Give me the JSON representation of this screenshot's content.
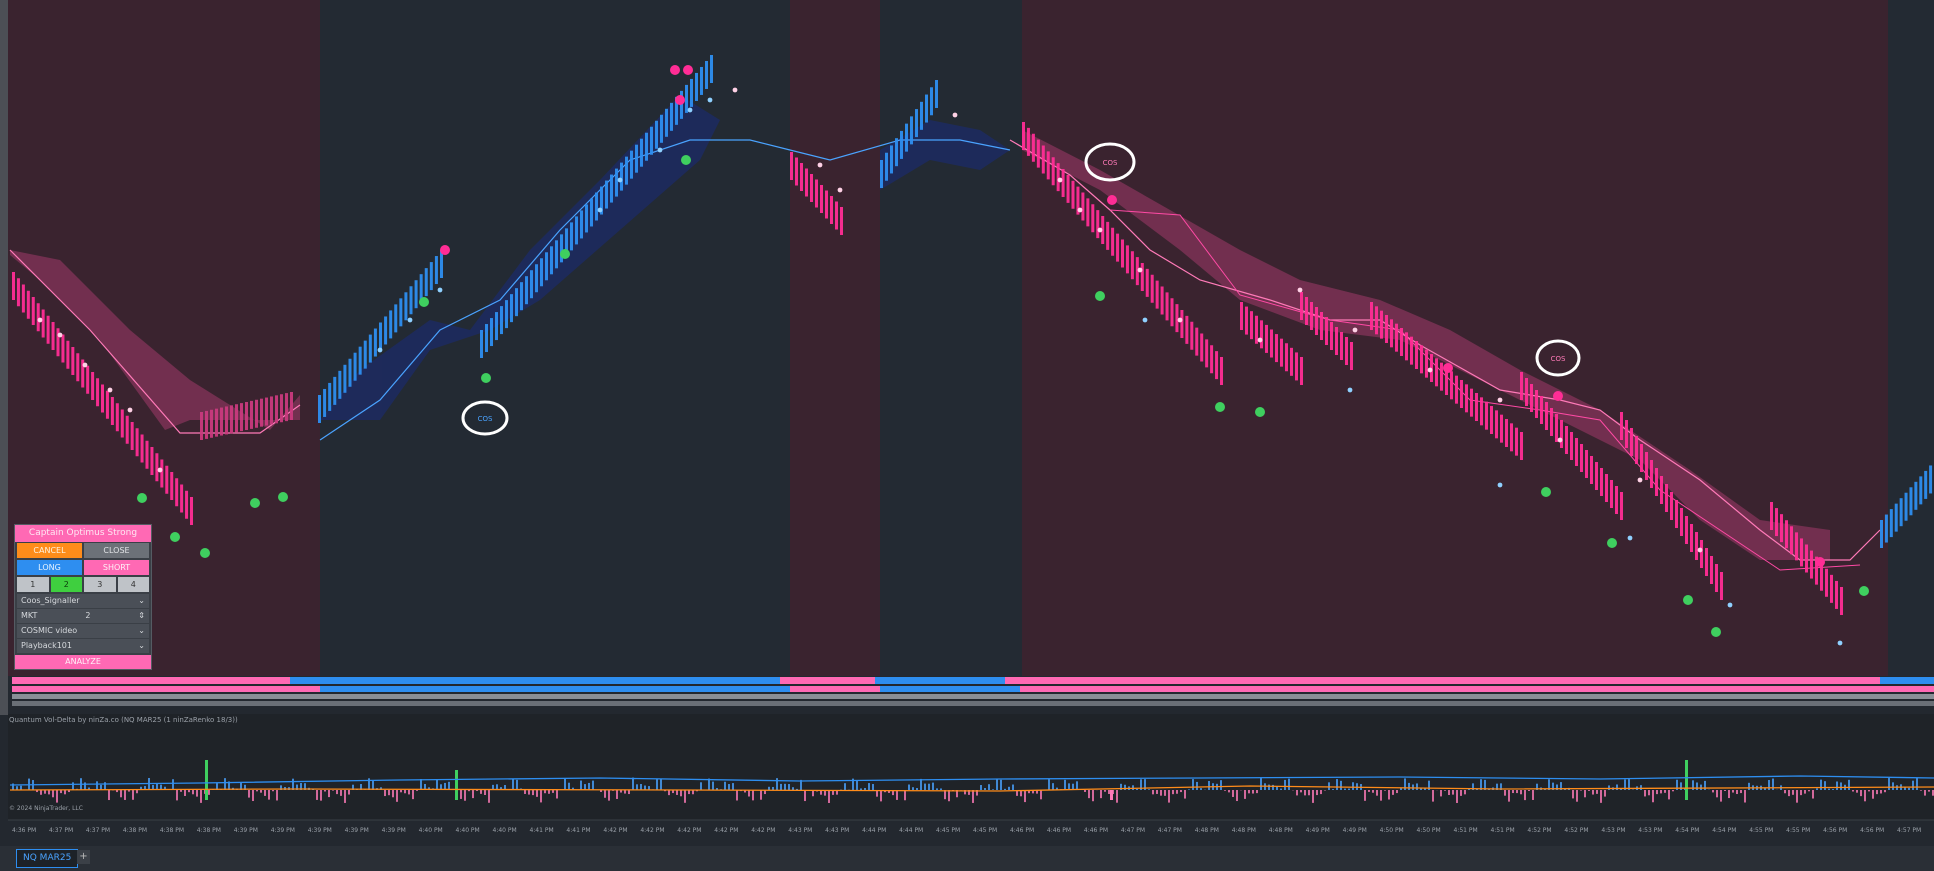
{
  "colors": {
    "background": "#23282f",
    "bear_zone": "#3a232f",
    "bull_zone": "#232a33",
    "pink": "#ff2d95",
    "pink_soft": "#ff7ab8",
    "blue": "#2e8ef0",
    "navy_band": "#1a2a7a",
    "green": "#3fcf5f",
    "orange_line": "#ff8c1a",
    "white_ring": "#ffffff"
  },
  "cos_markers": [
    "COS",
    "COS",
    "COS"
  ],
  "panel": {
    "title": "Captain Optimus Strong",
    "cancel": "CANCEL",
    "close": "CLOSE",
    "long": "LONG",
    "short": "SHORT",
    "nums": [
      "1",
      "2",
      "3",
      "4"
    ],
    "active_num": "2",
    "strategy_select": "Coos_Signaller",
    "order_type": "MKT",
    "qty": "2",
    "video_select": "COSMIC video",
    "playback_select": "Playback101",
    "footer": "ANALYZE"
  },
  "subpanel": {
    "indicator_label": "Quantum Vol-Delta by ninZa.co (NQ MAR25 (1 ninZaRenko 18/3))",
    "copyright": "© 2024 NinjaTrader, LLC"
  },
  "time_axis": [
    "4:36 PM",
    "4:37 PM",
    "4:37 PM",
    "4:38 PM",
    "4:38 PM",
    "4:38 PM",
    "4:39 PM",
    "4:39 PM",
    "4:39 PM",
    "4:39 PM",
    "4:39 PM",
    "4:40 PM",
    "4:40 PM",
    "4:40 PM",
    "4:41 PM",
    "4:41 PM",
    "4:42 PM",
    "4:42 PM",
    "4:42 PM",
    "4:42 PM",
    "4:42 PM",
    "4:43 PM",
    "4:43 PM",
    "4:44 PM",
    "4:44 PM",
    "4:45 PM",
    "4:45 PM",
    "4:46 PM",
    "4:46 PM",
    "4:46 PM",
    "4:47 PM",
    "4:47 PM",
    "4:48 PM",
    "4:48 PM",
    "4:48 PM",
    "4:49 PM",
    "4:49 PM",
    "4:50 PM",
    "4:50 PM",
    "4:51 PM",
    "4:51 PM",
    "4:52 PM",
    "4:52 PM",
    "4:53 PM",
    "4:53 PM",
    "4:54 PM",
    "4:54 PM",
    "4:55 PM",
    "4:55 PM",
    "4:56 PM",
    "4:56 PM",
    "4:57 PM"
  ],
  "tab": {
    "instrument": "NQ MAR25",
    "add": "+"
  }
}
